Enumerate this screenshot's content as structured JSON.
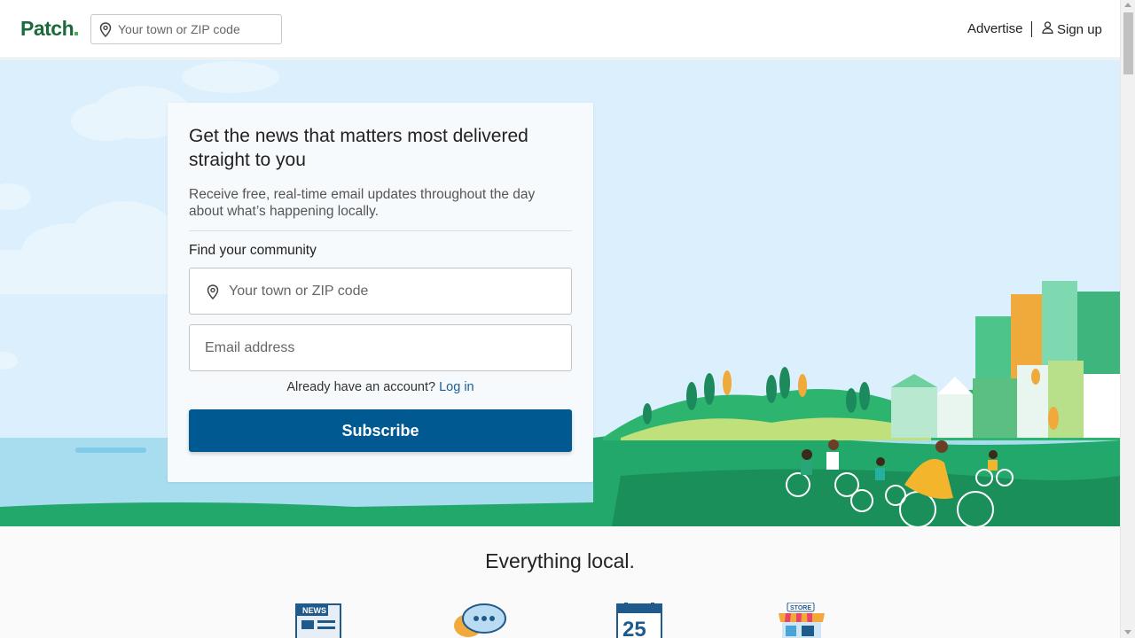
{
  "header": {
    "logo": "Patch",
    "search_placeholder": "Your town or ZIP code",
    "advertise": "Advertise",
    "signup": "Sign up"
  },
  "signup_card": {
    "headline": "Get the news that matters most delivered straight to you",
    "subtext": "Receive free, real-time email updates throughout the day about what’s happening locally.",
    "community_label": "Find your community",
    "town_placeholder": "Your town or ZIP code",
    "email_placeholder": "Email address",
    "account_prompt": "Already have an account?",
    "login_link": "Log in",
    "subscribe_label": "Subscribe"
  },
  "features": {
    "heading": "Everything local.",
    "icons": [
      {
        "name": "news-icon",
        "text": "NEWS"
      },
      {
        "name": "chat-icon",
        "text": ""
      },
      {
        "name": "calendar-icon",
        "text": "25"
      },
      {
        "name": "store-icon",
        "text": "STORE"
      }
    ]
  },
  "colors": {
    "brand_green": "#1b6b3a",
    "subscribe_blue": "#005a91",
    "link_blue": "#1a5f96",
    "sky": "#dbeffc",
    "grass": "#22a86a"
  }
}
